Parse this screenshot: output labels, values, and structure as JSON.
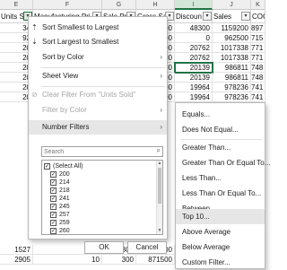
{
  "columns": {
    "letters": [
      "E",
      "F",
      "G",
      "H",
      "I",
      "J",
      "K"
    ],
    "headers": [
      "Units So",
      "Manufacturing Pri",
      "Sale Pri",
      "Gross Sal",
      "Discoun",
      "Sales",
      "COG"
    ]
  },
  "rows": [
    {
      "e": "34",
      "h": "500",
      "i": "48300",
      "j": "1159200",
      "k": "897"
    },
    {
      "e": "92",
      "h": "500",
      "i": "0",
      "j": "962500",
      "k": "715"
    },
    {
      "e": "20",
      "h": "500",
      "i": "20762",
      "j": "1017338",
      "k": "771"
    },
    {
      "e": "20",
      "h": "500",
      "i": "20762",
      "j": "1017338",
      "k": "771"
    },
    {
      "e": "20",
      "h": "500",
      "i": "20139",
      "j": "986811",
      "k": "748"
    },
    {
      "e": "20",
      "h": "500",
      "i": "20139",
      "j": "986811",
      "k": "748"
    },
    {
      "e": "20",
      "h": "500",
      "i": "19964",
      "j": "978236",
      "k": "741"
    },
    {
      "e": "20",
      "h": "500",
      "i": "19964",
      "j": "978236",
      "k": "741"
    }
  ],
  "bottom_rows": [
    {
      "e": "1527",
      "f": "260",
      "g": "300",
      "h": "458100"
    },
    {
      "e": "2905",
      "f": "10",
      "g": "300",
      "h": "871500"
    }
  ],
  "filter_menu": {
    "sort_asc": "Sort Smallest to Largest",
    "sort_desc": "Sort Largest to Smallest",
    "sort_by_color": "Sort by Color",
    "sheet_view": "Sheet View",
    "clear_filter": "Clear Filter From \"Units Sold\"",
    "filter_by_color": "Filter by Color",
    "number_filters": "Number Filters",
    "search_placeholder": "Search",
    "list_items": [
      "(Select All)",
      "200",
      "214",
      "218",
      "241",
      "245",
      "257",
      "259",
      "260"
    ],
    "ok": "OK",
    "cancel": "Cancel"
  },
  "number_filters_submenu": {
    "items": [
      "Equals...",
      "Does Not Equal...",
      "Greater Than...",
      "Greater Than Or Equal To...",
      "Less Than...",
      "Less Than Or Equal To...",
      "Between...",
      "Top 10...",
      "Above Average",
      "Below Average",
      "Custom Filter..."
    ],
    "highlighted": "Top 10..."
  },
  "colors": {
    "accent": "#217346",
    "menu_highlight": "#e6e6e6"
  }
}
